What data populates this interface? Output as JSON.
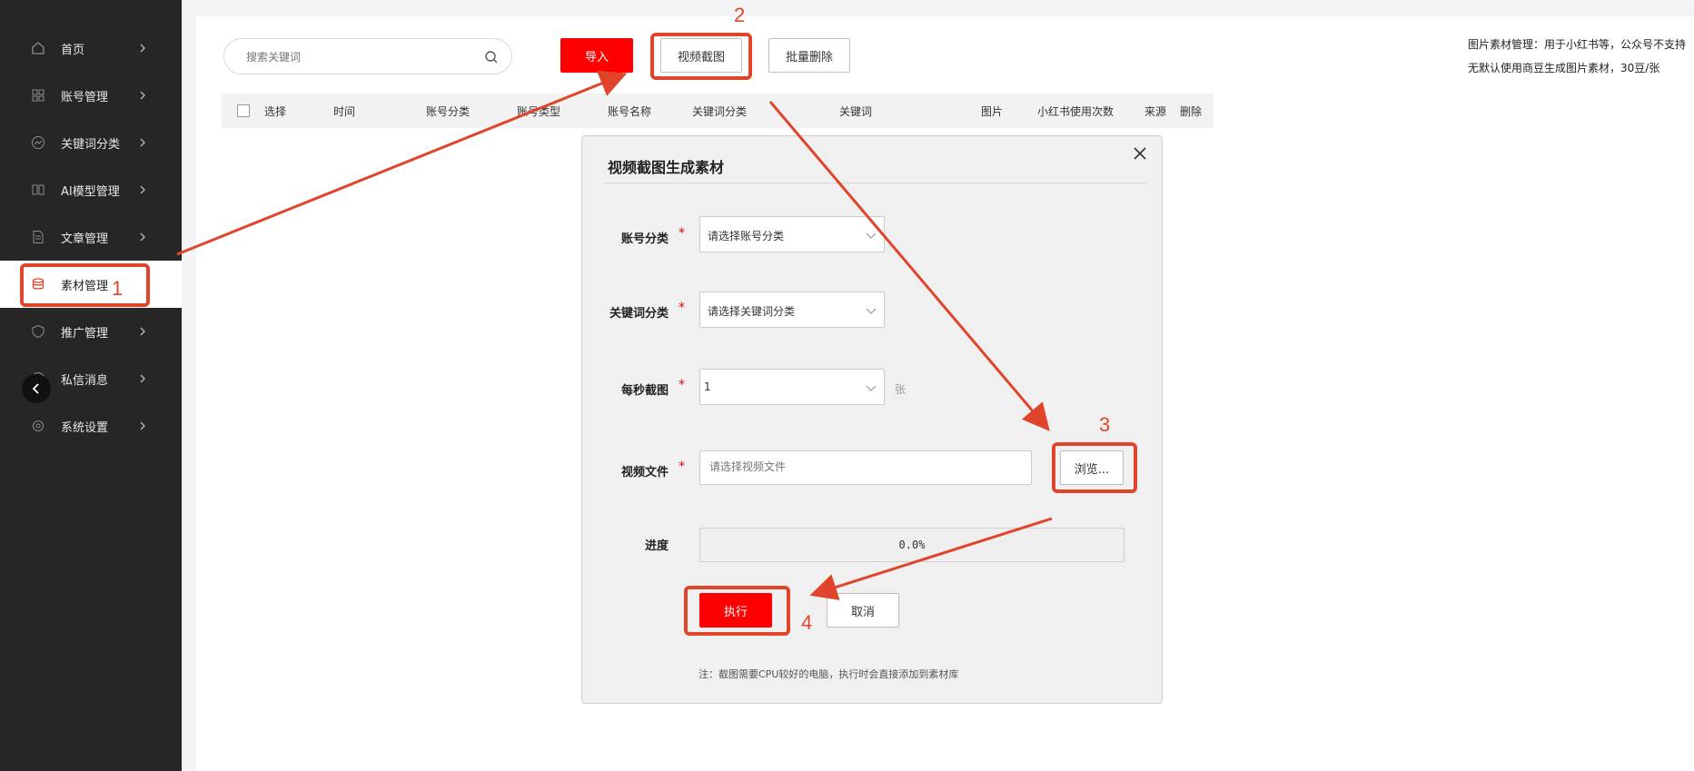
{
  "sidebar": {
    "items": [
      {
        "label": "首页",
        "icon": "home-icon",
        "name": "sidebar-item-home"
      },
      {
        "label": "账号管理",
        "icon": "grid-icon",
        "name": "sidebar-item-accounts"
      },
      {
        "label": "关键词分类",
        "icon": "trend-icon",
        "name": "sidebar-item-keyword-category"
      },
      {
        "label": "AI模型管理",
        "icon": "book-icon",
        "name": "sidebar-item-ai-models"
      },
      {
        "label": "文章管理",
        "icon": "document-icon",
        "name": "sidebar-item-articles"
      },
      {
        "label": "素材管理",
        "icon": "database-icon",
        "name": "sidebar-item-materials",
        "active": true
      },
      {
        "label": "推广管理",
        "icon": "shield-icon",
        "name": "sidebar-item-promotion"
      },
      {
        "label": "私信消息",
        "icon": "message-icon",
        "name": "sidebar-item-messages"
      },
      {
        "label": "系统设置",
        "icon": "gear-icon",
        "name": "sidebar-item-settings"
      }
    ]
  },
  "toolbar": {
    "search_placeholder": "搜索关键词",
    "import_label": "导入",
    "video_capture_label": "视频截图",
    "batch_delete_label": "批量删除"
  },
  "table": {
    "columns": [
      "选择",
      "时间",
      "账号分类",
      "账号类型",
      "账号名称",
      "关键词分类",
      "关键词",
      "图片",
      "小红书使用次数",
      "来源",
      "删除"
    ]
  },
  "help": {
    "line1": "图片素材管理：用于小红书等，公众号不支持",
    "line2": "无默认使用商豆生成图片素材，30豆/张"
  },
  "dialog": {
    "title": "视频截图生成素材",
    "account_category_label": "账号分类",
    "account_category_value": "请选择账号分类",
    "keyword_category_label": "关键词分类",
    "keyword_category_value": "请选择关键词分类",
    "per_second_label": "每秒截图",
    "per_second_value": "1",
    "per_second_unit": "张",
    "video_file_label": "视频文件",
    "video_file_placeholder": "请选择视频文件",
    "browse_label": "浏览...",
    "progress_label": "进度",
    "progress_text": "0.0%",
    "progress_value": 0.0,
    "execute_label": "执行",
    "cancel_label": "取消",
    "note": "注：截图需要CPU较好的电脑，执行时会直接添加到素材库",
    "required_mark": "*"
  },
  "annotations": {
    "step1": "1",
    "step2": "2",
    "step3": "3",
    "step4": "4",
    "color": "#e0452b"
  }
}
